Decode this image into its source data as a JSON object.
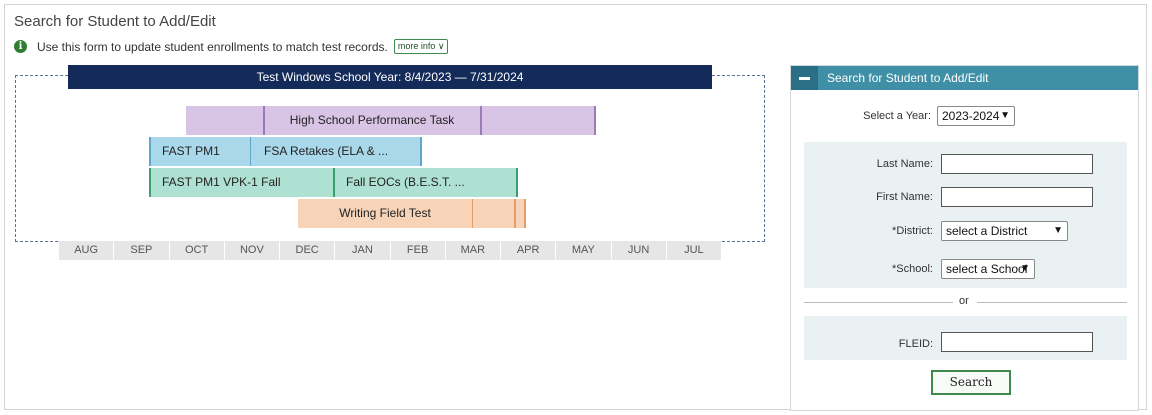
{
  "page": {
    "title": "Search for Student to Add/Edit",
    "info_text": "Use this form to update student enrollments to match test records.",
    "more_info_label": "more info ∨"
  },
  "timeline": {
    "header": "Test Windows School Year: 8/4/2023 — 7/31/2024",
    "bars": [
      {
        "label": "High School Performance Task",
        "color": "purple"
      },
      {
        "label": "FAST PM1",
        "color": "blue"
      },
      {
        "label": "FSA Retakes (ELA & ...",
        "color": "blue"
      },
      {
        "label": "FAST PM1 VPK-1 Fall",
        "color": "teal"
      },
      {
        "label": "Fall EOCs (B.E.S.T. ...",
        "color": "teal"
      },
      {
        "label": "Writing Field Test",
        "color": "peach"
      }
    ],
    "months": [
      "AUG",
      "SEP",
      "OCT",
      "NOV",
      "DEC",
      "JAN",
      "FEB",
      "MAR",
      "APR",
      "MAY",
      "JUN",
      "JUL"
    ]
  },
  "search_panel": {
    "title": "Search for Student to Add/Edit",
    "year_label": "Select a Year:",
    "year_value": "2023-2024",
    "last_name_label": "Last Name:",
    "first_name_label": "First Name:",
    "district_label": "*District:",
    "district_value": "select a District",
    "school_label": "*School:",
    "school_value": "select a School",
    "or_label": "or",
    "fleid_label": "FLEID:",
    "search_button": "Search"
  }
}
